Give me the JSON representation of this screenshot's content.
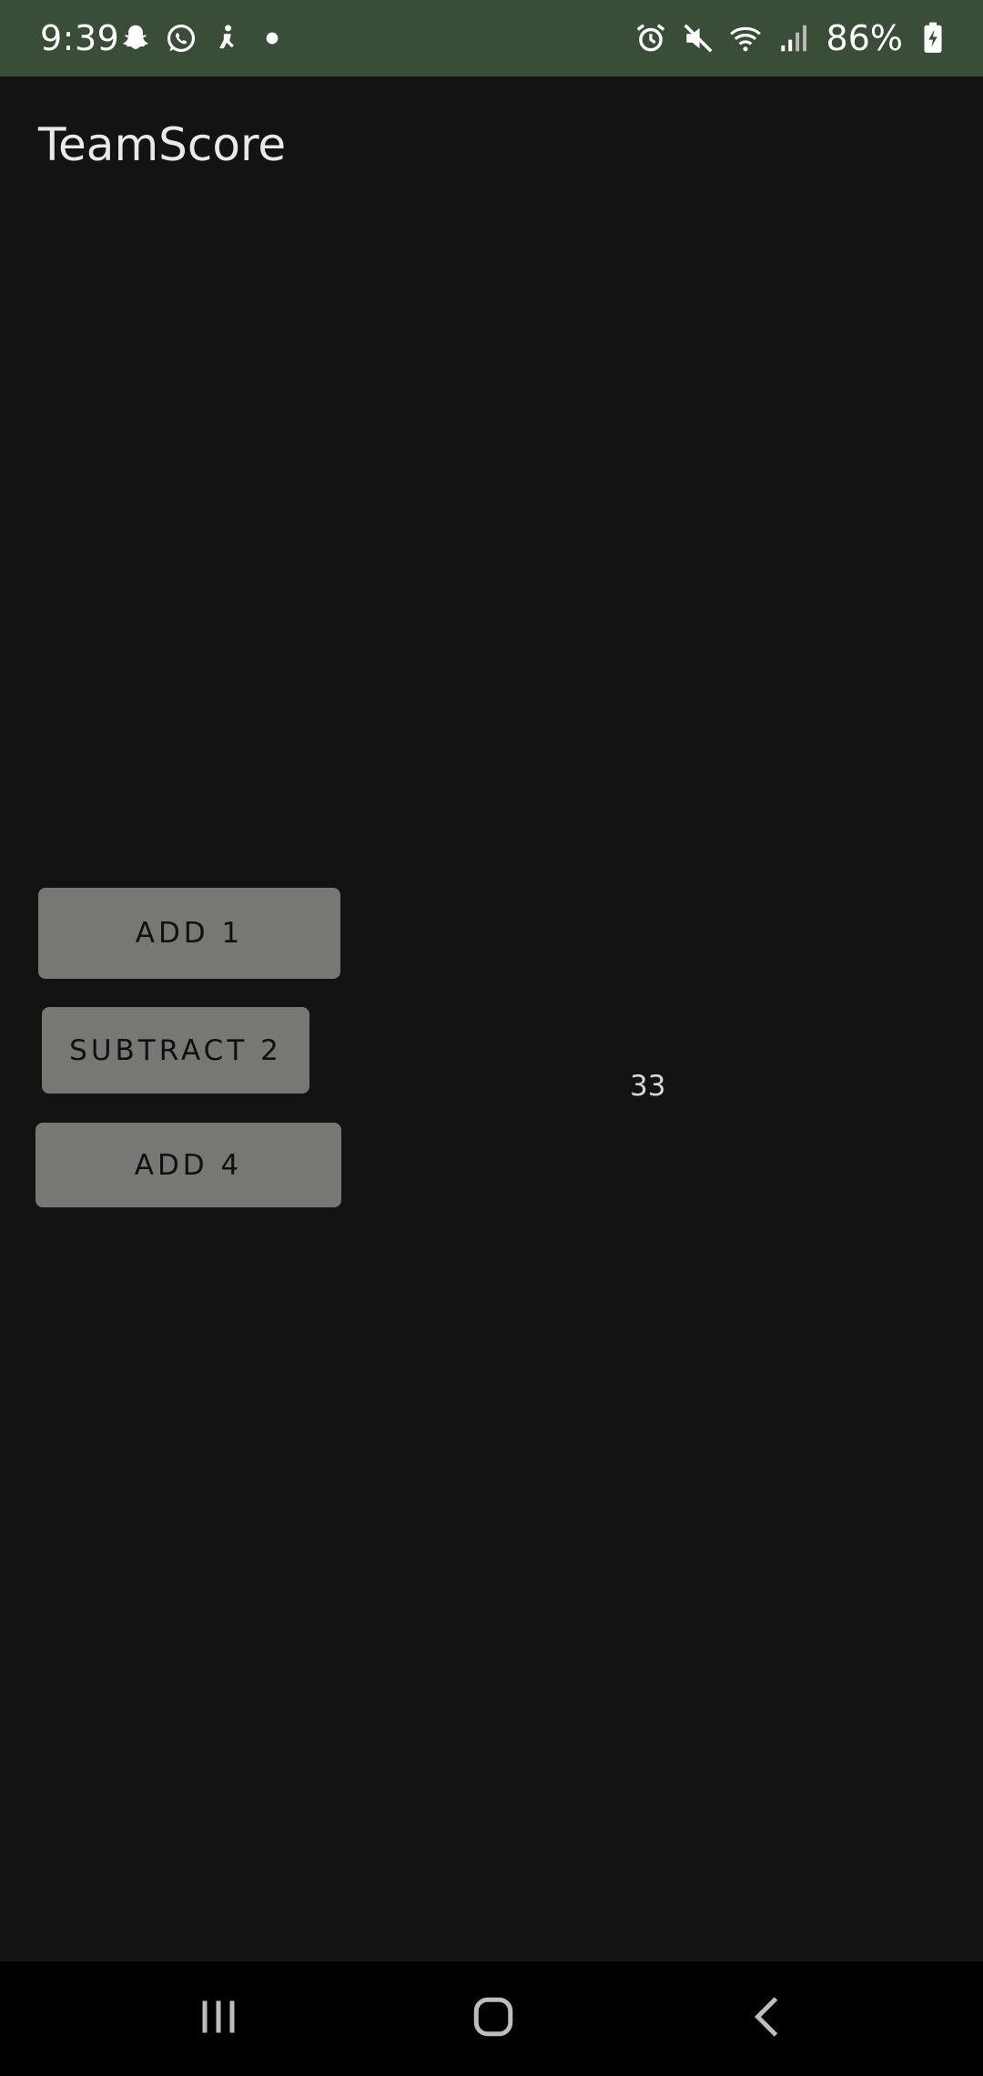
{
  "status_bar": {
    "time": "9:39",
    "battery": "86%",
    "background_color": "#3a4d38",
    "left_icons": [
      "snapchat-icon",
      "whatsapp-icon",
      "app-notification-icon",
      "dot-icon"
    ],
    "right_icons": [
      "alarm-icon",
      "mute-icon",
      "wifi-icon",
      "signal-icon",
      "battery-charging-icon"
    ]
  },
  "app": {
    "title": "TeamScore",
    "background_color": "#131313"
  },
  "buttons": {
    "add1_label": "ADD 1",
    "subtract2_label": "SUBTRACT 2",
    "add4_label": "ADD 4",
    "button_color": "#777774"
  },
  "score": {
    "value": "33"
  },
  "nav_bar": {
    "icons": [
      "recents-icon",
      "home-icon",
      "back-icon"
    ]
  }
}
